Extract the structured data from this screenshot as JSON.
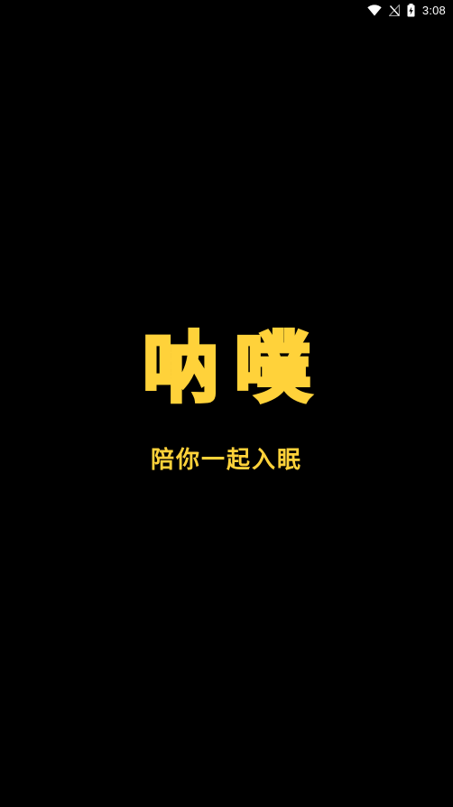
{
  "status_bar": {
    "time": "3:08",
    "icons": [
      "wifi-icon",
      "no-signal-icon",
      "battery-charging-icon"
    ]
  },
  "splash": {
    "logo_text": "呐噗",
    "tagline": "陪你一起入眠"
  },
  "colors": {
    "background": "#000000",
    "brand_yellow": "#ffd23a",
    "status_text": "#ffffff"
  }
}
